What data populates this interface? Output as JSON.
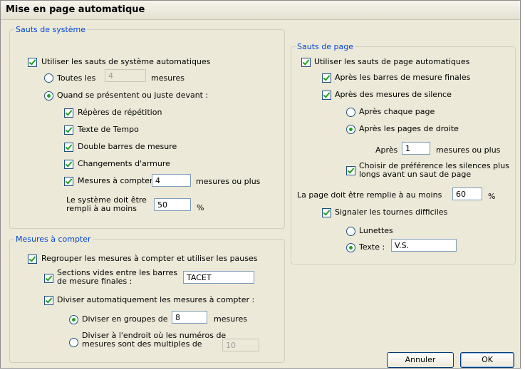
{
  "window": {
    "title": "Mise en page automatique"
  },
  "systeme": {
    "legend": "Sauts de système",
    "use_auto": "Utiliser les sauts de système automatiques",
    "toutes_les": "Toutes les",
    "toutes_value": "4",
    "mesures": "mesures",
    "quand": "Quand se présentent ou juste devant :",
    "reperes": "Répères de répétition",
    "tempo": "Texte de Tempo",
    "double": "Double barres de mesure",
    "armure": "Changements d'armure",
    "compter": "Mesures à compter",
    "compter_value": "4",
    "mesures_ou_plus": "mesures ou plus",
    "rempli_line1": "Le système doit être",
    "rempli_line2": "rempli à au moins",
    "rempli_value": "50",
    "percent": "%"
  },
  "compter": {
    "legend": "Mesures à compter",
    "regrouper": "Regrouper les mesures à compter et utiliser les pauses",
    "sections_line1": "Sections vides entre les barres",
    "sections_line2": "de mesure finales :",
    "sections_value": "TACET",
    "diviser": "Diviser automatiquement les mesures à compter :",
    "groupes": "Diviser en groupes de",
    "groupes_value": "8",
    "mesures": "mesures",
    "multiples_line1": "Diviser à l'endroit où les numéros de",
    "multiples_line2": "mesures sont des multiples de",
    "multiples_value": "10"
  },
  "page": {
    "legend": "Sauts de page",
    "use_auto": "Utiliser les sauts de page automatiques",
    "finales": "Après les barres de mesure finales",
    "silence": "Après des mesures de silence",
    "chaque": "Après chaque page",
    "droite": "Après les pages de droite",
    "apres": "Après",
    "apres_value": "1",
    "mesures_ou_plus": "mesures ou plus",
    "choisir_line1": "Choisir de préférence les silences plus",
    "choisir_line2": "longs avant un saut de page",
    "remplie": "La page doit être remplie à au moins",
    "remplie_value": "60",
    "percent": "%",
    "signaler": "Signaler les tournes difficiles",
    "lunettes": "Lunettes",
    "texte": "Texte :",
    "texte_value": "V.S."
  },
  "buttons": {
    "cancel": "Annuler",
    "ok": "OK"
  }
}
